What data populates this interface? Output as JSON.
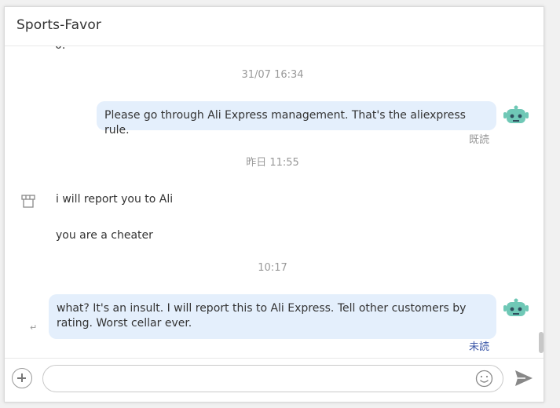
{
  "header": {
    "title": "Sports-Favor"
  },
  "messages": {
    "cut_text": "0. ",
    "ts1": "31/07 16:34",
    "msg1": "Please go through Ali Express management.  That's the aliexpress rule.",
    "read1": "既読",
    "ts2": "昨日 11:55",
    "in1": "i will report you to Ali",
    "in2": "you are a cheater",
    "ts3": "10:17",
    "msg2_line1": "what? It's an insult. I will report this to Ali Express. Tell other customers by",
    "msg2_line2": "rating. Worst cellar ever.",
    "read2": "未読"
  },
  "composer": {
    "value": "",
    "placeholder": ""
  },
  "icons": {
    "bot_avatar": "robot-icon",
    "shop": "shop-icon",
    "reply": "reply-icon",
    "add": "plus-icon",
    "emoji": "emoji-icon",
    "send": "send-icon"
  },
  "colors": {
    "outgoing_bubble": "#e4effc",
    "bot_teal": "#6fc8b6",
    "unread_text": "#3b57a7",
    "read_text": "#999999"
  }
}
